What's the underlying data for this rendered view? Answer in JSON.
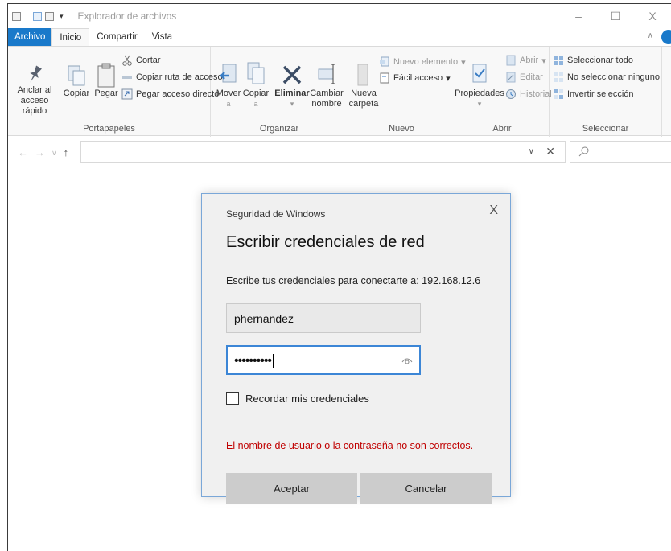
{
  "window": {
    "title": "Explorador de archivos",
    "controls": {
      "minimize": "–",
      "maximize": "☐",
      "close": "X"
    }
  },
  "ribbon_tabs": [
    "Archivo",
    "Inicio",
    "Compartir",
    "Vista"
  ],
  "ribbon": {
    "portapapeles": {
      "label": "Portapapeles",
      "anclar_line1": "Anclar al",
      "anclar_line2": "acceso rápido",
      "copiar": "Copiar",
      "pegar": "Pegar",
      "cortar": "Cortar",
      "copiar_ruta": "Copiar ruta de acceso",
      "pegar_acceso": "Pegar acceso directo"
    },
    "organizar": {
      "label": "Organizar",
      "mover_line1": "Mover",
      "mover_line2": "a",
      "copiar_line1": "Copiar",
      "copiar_line2": "a",
      "eliminar": "Eliminar",
      "cambiar_line1": "Cambiar",
      "cambiar_line2": "nombre"
    },
    "nuevo": {
      "label": "Nuevo",
      "nueva_line1": "Nueva",
      "nueva_line2": "carpeta",
      "nuevo_elemento": "Nuevo elemento",
      "facil_acceso": "Fácil acceso"
    },
    "abrir": {
      "label": "Abrir",
      "propiedades": "Propiedades",
      "abrir": "Abrir",
      "editar": "Editar",
      "historial": "Historial"
    },
    "seleccionar": {
      "label": "Seleccionar",
      "todo": "Seleccionar todo",
      "ninguno": "No seleccionar ninguno",
      "invertir": "Invertir selección"
    }
  },
  "address_bar": {
    "value": ""
  },
  "search": {
    "placeholder": ""
  },
  "dialog": {
    "caption": "Seguridad de Windows",
    "close": "X",
    "heading": "Escribir credenciales de red",
    "description": "Escribe tus credenciales para conectarte a: 192.168.12.6",
    "username": "phernandez",
    "password_mask": "••••••••••",
    "remember_label": "Recordar mis credenciales",
    "remember_checked": false,
    "error": "El nombre de usuario o la contraseña no son correctos.",
    "ok_label": "Aceptar",
    "cancel_label": "Cancelar"
  }
}
